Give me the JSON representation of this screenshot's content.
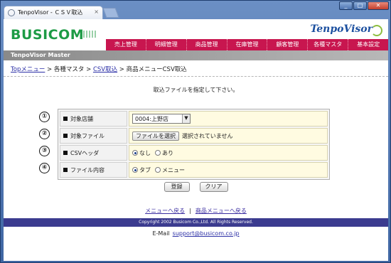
{
  "browser": {
    "tab_title": "TenpoVisor - ＣＳＶ取込",
    "tab_close": "×",
    "window_buttons": [
      "_",
      "□",
      "✕"
    ]
  },
  "header": {
    "logo": "BUSICOM",
    "brand": "TenpoVisor",
    "nav": [
      "売上管理",
      "明細管理",
      "商品管理",
      "在庫管理",
      "顧客管理",
      "各種マスタ",
      "基本設定"
    ],
    "app_title": "TenpoVisor Master"
  },
  "breadcrumb": {
    "top": "Topメニュー",
    "sep1": " > ",
    "masters": "各種マスタ",
    "sep2": " > ",
    "csv": "CSV取込",
    "sep3": " > ",
    "current": "商品メニューCSV取込"
  },
  "prompt": "取込ファイルを指定して下さい。",
  "markers": [
    "①",
    "②",
    "③",
    "④"
  ],
  "form": {
    "store_label": "対象店舗",
    "store_value": "0004:上野店",
    "file_label": "対象ファイル",
    "file_button": "ファイルを選択",
    "file_status": "選択されていません",
    "header_label": "CSVヘッダ",
    "header_options": [
      "なし",
      "あり"
    ],
    "header_selected": "なし",
    "content_label": "ファイル内容",
    "content_options": [
      "タブ",
      "メニュー"
    ],
    "content_selected": "タブ"
  },
  "actions": {
    "register": "登録",
    "clear": "クリア"
  },
  "footer": {
    "menu_back": "メニューへ戻る",
    "separator": "|",
    "product_menu_back": "商品メニューへ戻る",
    "copyright": "Copyright 2002 Busicom Co.,Ltd. All Rights Reserved.",
    "email_label": "E-Mail",
    "email": "support@busicom.co.jp"
  }
}
